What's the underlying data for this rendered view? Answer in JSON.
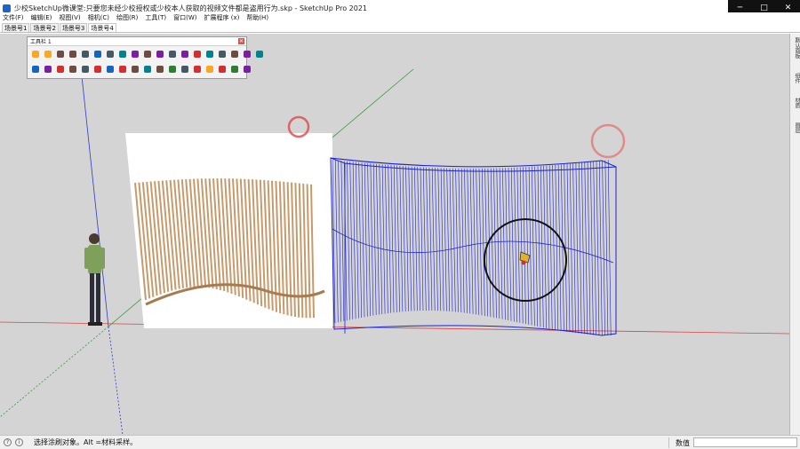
{
  "window": {
    "title": "少校SketchUp微课堂:只要您未经少校授权或少校本人获取的视频文件都是盗用行为.skp - SketchUp Pro 2021",
    "minimize": "─",
    "maximize": "□",
    "close": "✕"
  },
  "menu": [
    "文件(F)",
    "编辑(E)",
    "视图(V)",
    "相机(C)",
    "绘图(R)",
    "工具(T)",
    "窗口(W)",
    "扩展程序 (x)",
    "帮助(H)"
  ],
  "scenes": [
    "场景号1",
    "场景号2",
    "场景号3",
    "场景号4"
  ],
  "active_scene_index": 3,
  "toolbar": {
    "title": "工具栏 1",
    "close_label": "✕",
    "row1_icons": [
      "select-icon",
      "arc-icon",
      "component-icon",
      "rotate-icon",
      "eraser-icon",
      "paint-icon",
      "followme-icon",
      "move-icon",
      "pushpull-icon",
      "tape-icon",
      "protractor-icon",
      "dimension-icon",
      "text-icon",
      "axes-icon",
      "section-icon",
      "solid-icon",
      "sandbox-icon",
      "orbit-icon",
      "pan-icon"
    ],
    "row2_icons": [
      "push-icon",
      "stamp-icon",
      "drape-icon",
      "smoove-icon",
      "drape2-icon",
      "flip-icon",
      "addprofile-icon",
      "detail-icon",
      "extrude-icon",
      "sculpt-icon",
      "warehouse-icon",
      "lock-icon",
      "3dtext-icon",
      "ruby-icon",
      "xray-icon",
      "hidden-icon",
      "style-icon",
      "scale-icon"
    ],
    "accent_colors": [
      "#d32f2f",
      "#1565c0",
      "#2e7d32",
      "#f9a825",
      "#6d4c41",
      "#7b1fa2",
      "#00838f",
      "#455a64"
    ]
  },
  "right_tray": {
    "tabs": [
      "默认面板",
      "组件",
      "材质",
      "图层"
    ]
  },
  "scene": {
    "selection_color": "#1a22d6",
    "slat_color": "#c79a6b",
    "axis_colors": {
      "red": "#d44",
      "green": "#3a9b3a",
      "blue": "#2a3ad0"
    },
    "cursor_circle_color": "#111111",
    "highlight_circle_color": "#e05050"
  },
  "status": {
    "help_icon": "?",
    "info_icon": "i",
    "message": "选择涂刷对象。Alt =材料采样。",
    "measure_label": "数值",
    "measure_value": ""
  }
}
